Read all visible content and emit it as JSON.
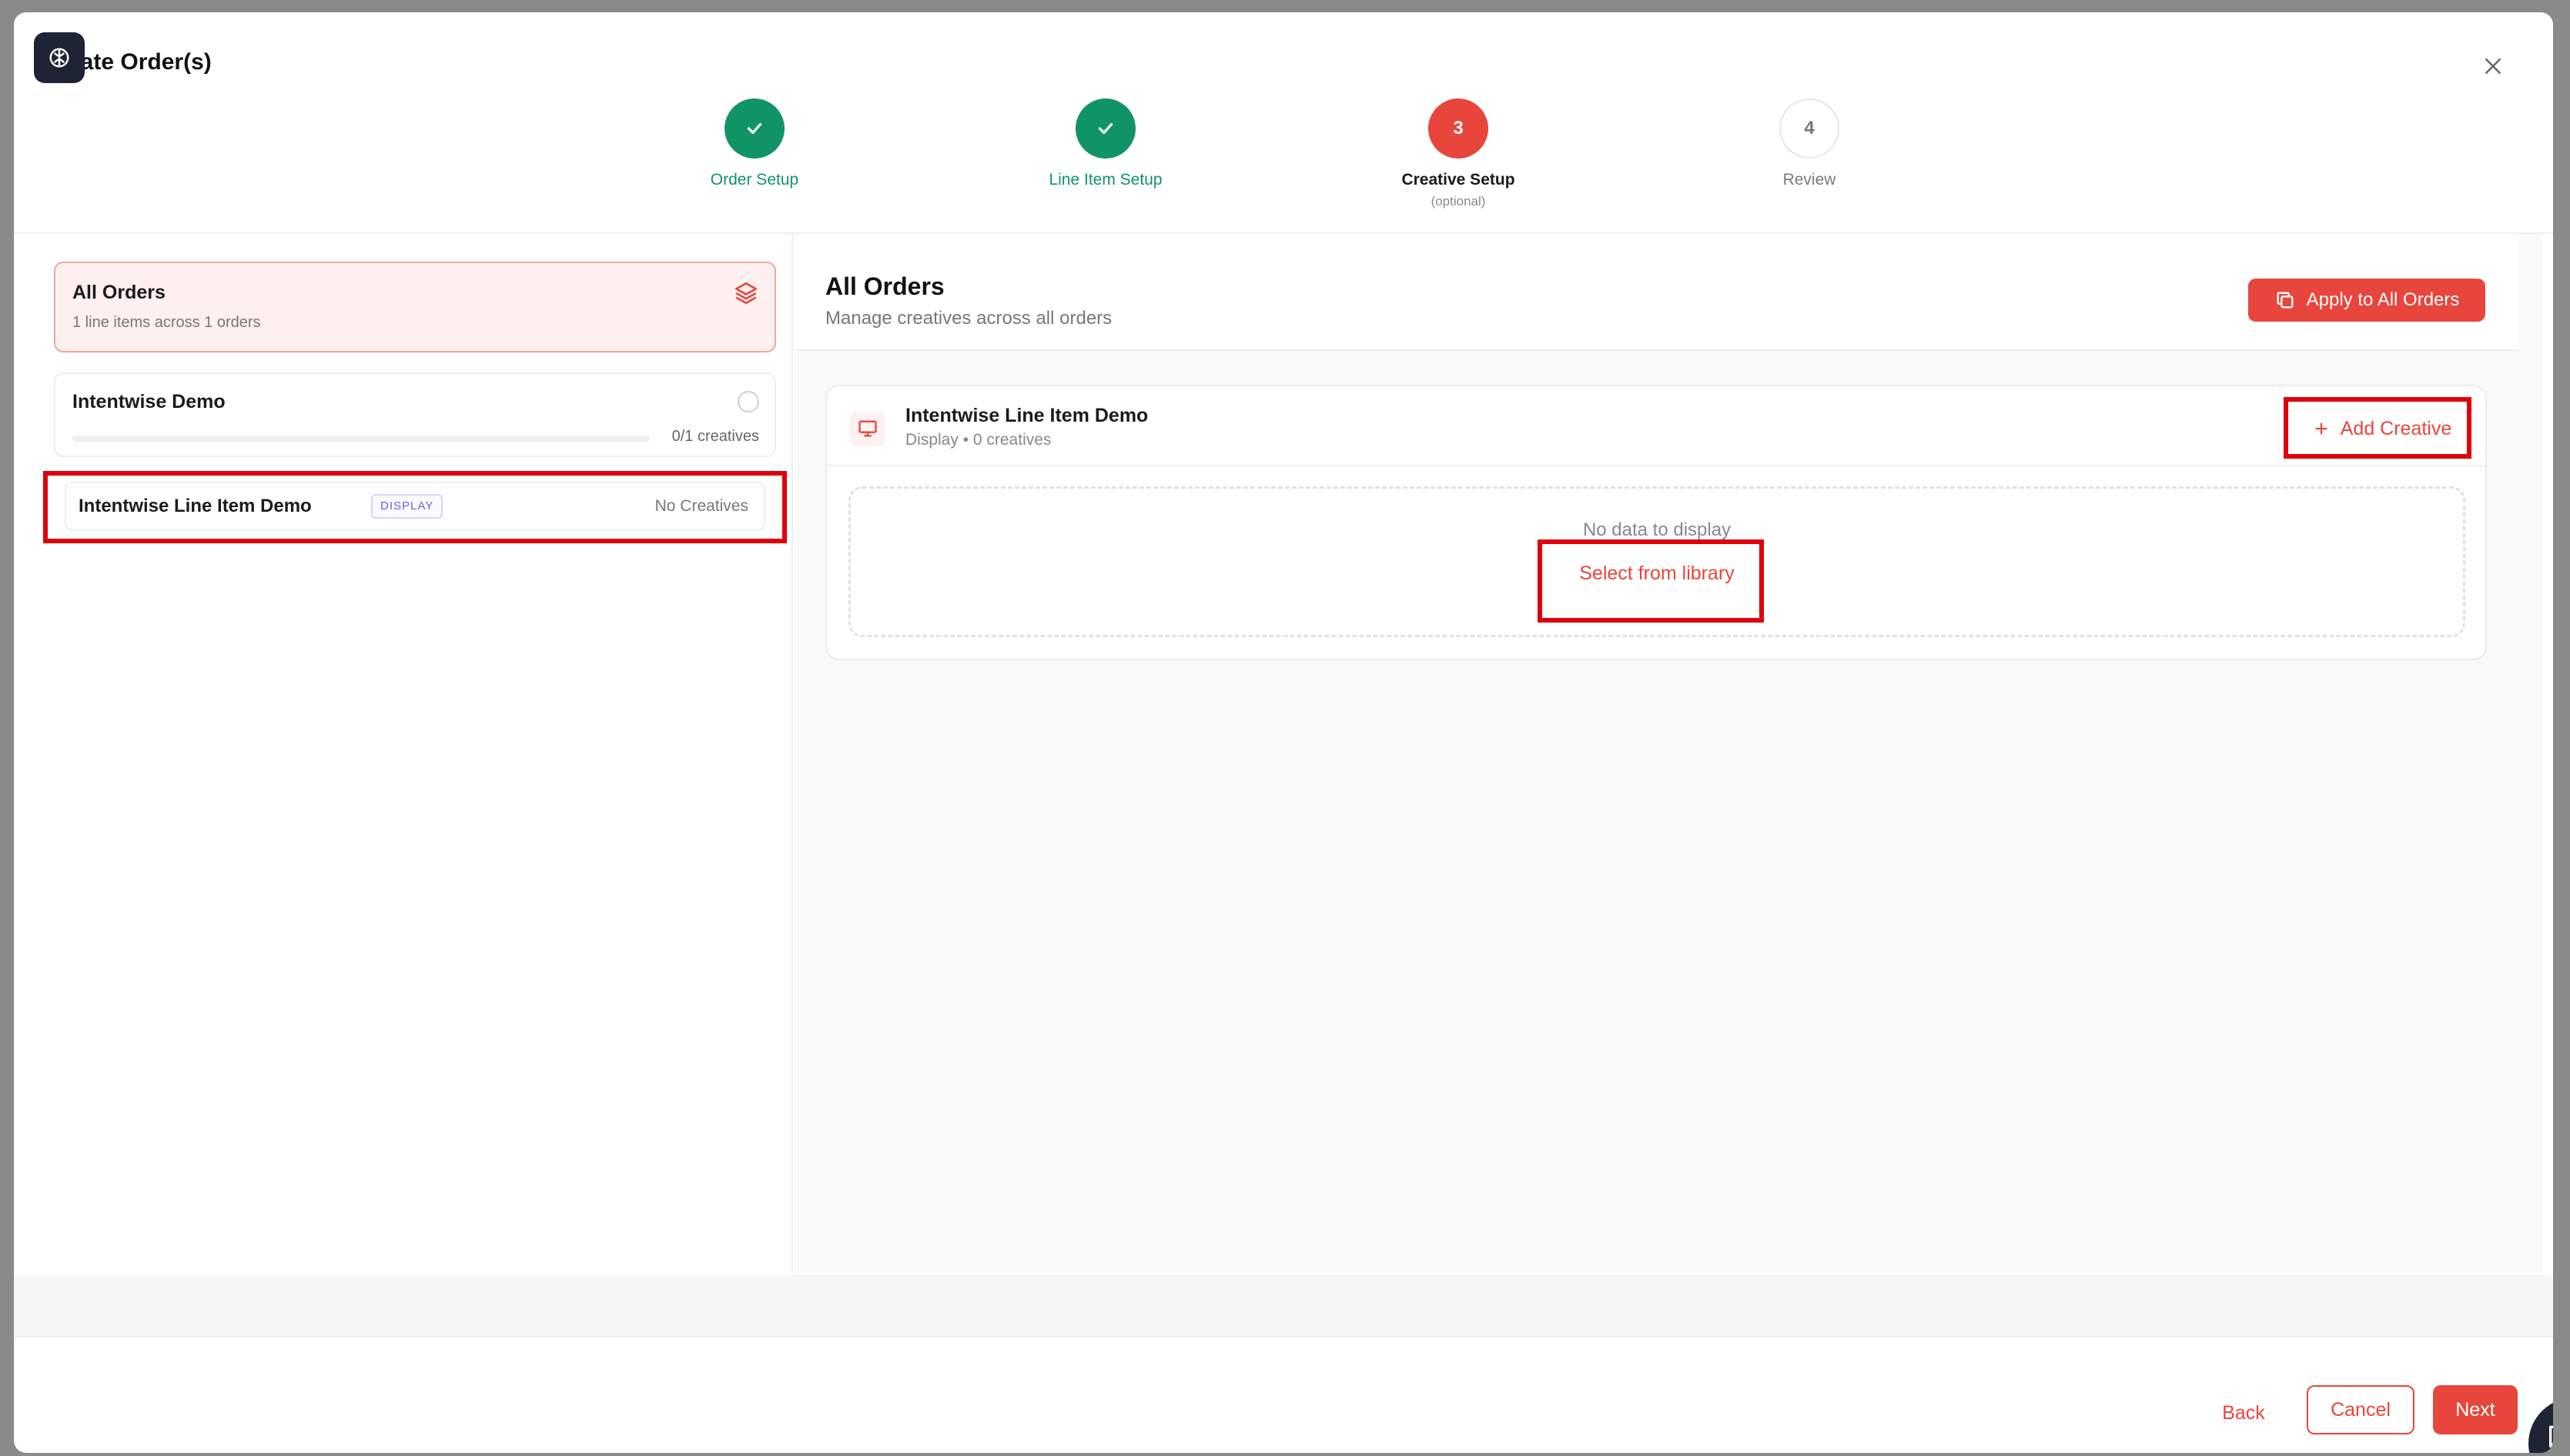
{
  "modal": {
    "title": "eate Order(s)"
  },
  "stepper": {
    "steps": [
      {
        "number": "1",
        "label": "Order Setup",
        "status": "done"
      },
      {
        "number": "2",
        "label": "Line Item Setup",
        "status": "done"
      },
      {
        "number": "3",
        "label": "Creative Setup",
        "sub": "(optional)",
        "status": "active"
      },
      {
        "number": "4",
        "label": "Review",
        "status": "pending"
      }
    ]
  },
  "sidebar": {
    "all_orders": {
      "title": "All Orders",
      "subtitle": "1 line items across 1 orders",
      "icon": "layers-icon"
    },
    "orders": [
      {
        "title": "Intentwise Demo",
        "progress_text": "0/1 creatives",
        "progress": 0,
        "line_items": [
          {
            "name": "Intentwise Line Item Demo",
            "badge": "DISPLAY",
            "status": "No Creatives"
          }
        ]
      }
    ]
  },
  "main": {
    "title": "All Orders",
    "subtitle": "Manage creatives across all orders",
    "apply_button": "Apply to All Orders",
    "line_item": {
      "name": "Intentwise Line Item Demo",
      "meta": "Display • 0 creatives",
      "add_button": "Add Creative",
      "empty_text": "No data to display",
      "select_link": "Select from library"
    }
  },
  "footer": {
    "back": "Back",
    "cancel": "Cancel",
    "next": "Next"
  },
  "colors": {
    "accent": "#e8453c",
    "success": "#119463",
    "highlight": "#e0000a"
  }
}
